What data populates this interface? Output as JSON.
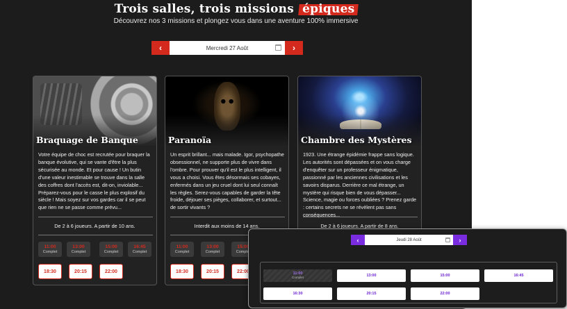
{
  "header": {
    "title_main": "Trois salles, trois missions",
    "title_accent": "épiques",
    "subtitle": "Découvrez nos 3 missions et plongez vous dans une aventure 100% immersive"
  },
  "date_picker": {
    "prev": "‹",
    "date": "Mercredi 27 Août",
    "next": "›",
    "accent_color": "#d42a1e"
  },
  "rooms": [
    {
      "title": "Braquage de Banque",
      "description": "Votre équipe de choc est recrutée pour braquer la banque évolutive, qui se vante d'être la plus sécurisée au monde. Et pour cause ! Un butin d'une valeur inestimable se trouve dans la salle des coffres dont l'accès est, dit-on, inviolable... Préparez-vous pour le casse le plus explosif du siècle ! Mais soyez sur vos gardes car il se peut que rien ne se passe comme prévu...",
      "info": "De 2 à 6 joueurs. A partir de 10 ans.",
      "full_slots": [
        {
          "time": "11:00",
          "status": "Complet"
        },
        {
          "time": "13:00",
          "status": "Complet"
        },
        {
          "time": "15:00",
          "status": "Complet"
        },
        {
          "time": "16:45",
          "status": "Complet"
        }
      ],
      "open_slots": [
        "18:30",
        "20:15",
        "22:00"
      ]
    },
    {
      "title": "Paranoïa",
      "description": "Un esprit brillant... mais malade. Igor, psychopathe obsessionnel, ne supporte plus de vivre dans l'ombre. Pour prouver qu'il est le plus intelligent, il vous a choisi. Vous êtes désormais ses cobayes, enfermés dans un jeu cruel dont lui seul connaît les règles. Serez-vous capables de garder la tête froide, déjouer ses pièges, collaborer, et surtout... de sortir vivants ?",
      "info": "Interdit aux moins de 14 ans.",
      "full_slots": [
        {
          "time": "11:00",
          "status": "Complet"
        },
        {
          "time": "13:00",
          "status": "Complet"
        },
        {
          "time": "15:00",
          "status": "Complet"
        }
      ],
      "open_slots": [
        "18:30",
        "20:15",
        "22:00"
      ]
    },
    {
      "title": "Chambre des Mystères",
      "description": "1923. Une étrange épidémie frappe sans logique. Les autorités sont dépassées et on vous charge d'enquêter sur un professeur énigmatique, passionné par les anciennes civilisations et les savoirs disparus. Derrière ce mal étrange, un mystère qui risque bien de vous dépasser... Science, magie ou forces oubliées ? Prenez garde : certains secrets ne se révèlent pas sans conséquences...",
      "info": "De 2 à 6 joueurs. A partir de 8 ans."
    }
  ],
  "overlay": {
    "prev": "‹",
    "date": "Jeudi 28 Août",
    "next": "›",
    "accent_color": "#7a2de0",
    "full_slot": {
      "time": "11:00",
      "status": "Complet"
    },
    "open_slots": [
      "13:00",
      "15:00",
      "16:45",
      "16:30",
      "20:15",
      "22:00"
    ]
  }
}
